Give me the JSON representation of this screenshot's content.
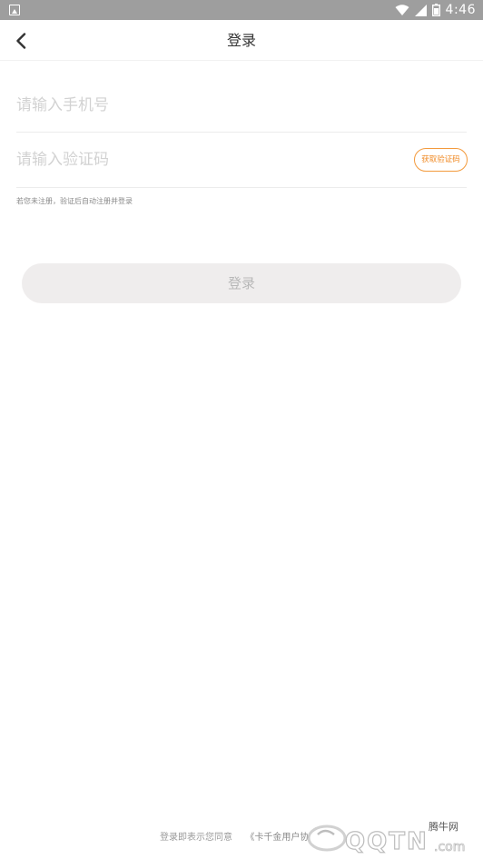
{
  "status_bar": {
    "time": "4:46",
    "icons": [
      "wifi-icon",
      "signal-icon",
      "battery-icon"
    ]
  },
  "header": {
    "back_icon": "chevron-left-icon",
    "title": "登录"
  },
  "form": {
    "phone": {
      "placeholder": "请输入手机号",
      "value": ""
    },
    "code": {
      "placeholder": "请输入验证码",
      "value": ""
    },
    "get_code_label": "获取验证码",
    "hint": "若您未注册，验证后自动注册并登录"
  },
  "login_button": {
    "label": "登录"
  },
  "footer": {
    "prefix": "登录即表示您同意",
    "agreement": "《卡千金用户协"
  },
  "watermark": {
    "site": "腾牛网",
    "logo": "QQTN.com"
  },
  "colors": {
    "accent": "#f08a24",
    "status_bar": "#9e9e9e",
    "button_bg": "#efeded"
  }
}
